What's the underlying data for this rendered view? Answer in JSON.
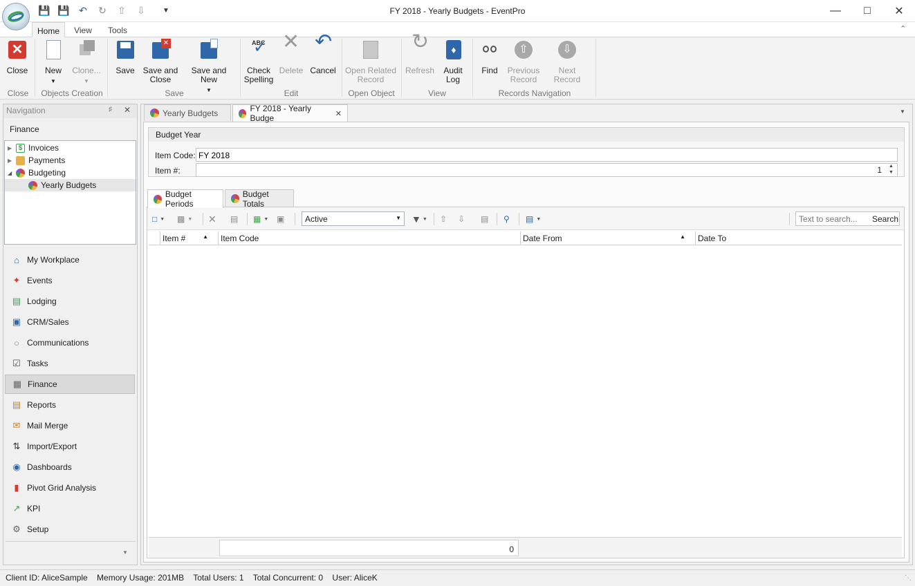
{
  "window": {
    "title": "FY 2018 - Yearly Budgets - EventPro"
  },
  "ribbon_tabs": [
    "Home",
    "View",
    "Tools"
  ],
  "ribbon": {
    "close": {
      "label": "Close",
      "group": "Close"
    },
    "new": {
      "label": "New"
    },
    "clone": {
      "label": "Clone..."
    },
    "objects_group": "Objects Creation",
    "save": {
      "label": "Save"
    },
    "save_close": {
      "line1": "Save and",
      "line2": "Close"
    },
    "save_new": {
      "label": "Save and New"
    },
    "save_group": "Save",
    "check_spelling": {
      "line1": "Check",
      "line2": "Spelling",
      "abc": "ABC"
    },
    "delete": {
      "label": "Delete"
    },
    "cancel": {
      "label": "Cancel"
    },
    "edit_group": "Edit",
    "open_related": {
      "line1": "Open Related",
      "line2": "Record"
    },
    "open_group": "Open Object",
    "refresh": {
      "label": "Refresh"
    },
    "audit_log": {
      "line1": "Audit",
      "line2": "Log"
    },
    "view_group": "View",
    "find": {
      "label": "Find"
    },
    "previous_record": {
      "line1": "Previous",
      "line2": "Record"
    },
    "next_record": {
      "label": "Next Record"
    },
    "records_group": "Records Navigation"
  },
  "navigation": {
    "title": "Navigation",
    "section": "Finance",
    "tree": [
      {
        "label": "Invoices"
      },
      {
        "label": "Payments"
      },
      {
        "label": "Budgeting"
      },
      {
        "label": "Yearly Budgets"
      }
    ],
    "items": [
      {
        "label": "My Workplace"
      },
      {
        "label": "Events"
      },
      {
        "label": "Lodging"
      },
      {
        "label": "CRM/Sales"
      },
      {
        "label": "Communications"
      },
      {
        "label": "Tasks"
      },
      {
        "label": "Finance"
      },
      {
        "label": "Reports"
      },
      {
        "label": "Mail Merge"
      },
      {
        "label": "Import/Export"
      },
      {
        "label": "Dashboards"
      },
      {
        "label": "Pivot Grid Analysis"
      },
      {
        "label": "KPI"
      },
      {
        "label": "Setup"
      }
    ]
  },
  "doc_tabs": [
    {
      "label": "Yearly Budgets"
    },
    {
      "label": "FY 2018 - Yearly Budge"
    }
  ],
  "budget_year": {
    "header": "Budget Year",
    "item_code_label": "Item Code:",
    "item_code_value": "FY 2018",
    "item_num_label": "Item #:",
    "item_num_value": "1"
  },
  "sub_tabs": [
    {
      "label": "Budget Periods"
    },
    {
      "label": "Budget Totals"
    }
  ],
  "grid": {
    "status_filter": "Active",
    "search_placeholder": "Text to search...",
    "search_button": "Search",
    "columns": [
      "Item #",
      "Item Code",
      "Date From",
      "Date To"
    ],
    "rows": [],
    "footer_count": "0"
  },
  "statusbar": {
    "text": "Client ID: AliceSample    Memory Usage: 201MB    Total Users: 1    Total Concurrent: 0    User: AliceK"
  }
}
